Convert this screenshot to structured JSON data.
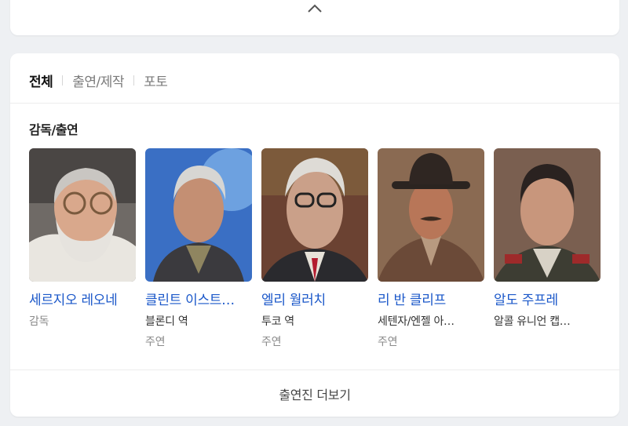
{
  "tabs": [
    {
      "label": "전체",
      "active": true
    },
    {
      "label": "출연/제작",
      "active": false
    },
    {
      "label": "포토",
      "active": false
    }
  ],
  "section_title": "감독/출연",
  "people": [
    {
      "name": "세르지오 레오네",
      "role": "",
      "category": "감독"
    },
    {
      "name": "클린트 이스트…",
      "role": "블론디 역",
      "category": "주연"
    },
    {
      "name": "엘리 월러치",
      "role": "투코 역",
      "category": "주연"
    },
    {
      "name": "리 반 클리프",
      "role": "세텐자/엔젤 아…",
      "category": "주연"
    },
    {
      "name": "알도 주프레",
      "role": "알콜 유니언 캡…",
      "category": ""
    }
  ],
  "more_label": "출연진 더보기",
  "icons": {
    "collapse": "chevron-up-icon"
  },
  "colors": {
    "link": "#1a57c9",
    "background": "#eef0f3"
  }
}
